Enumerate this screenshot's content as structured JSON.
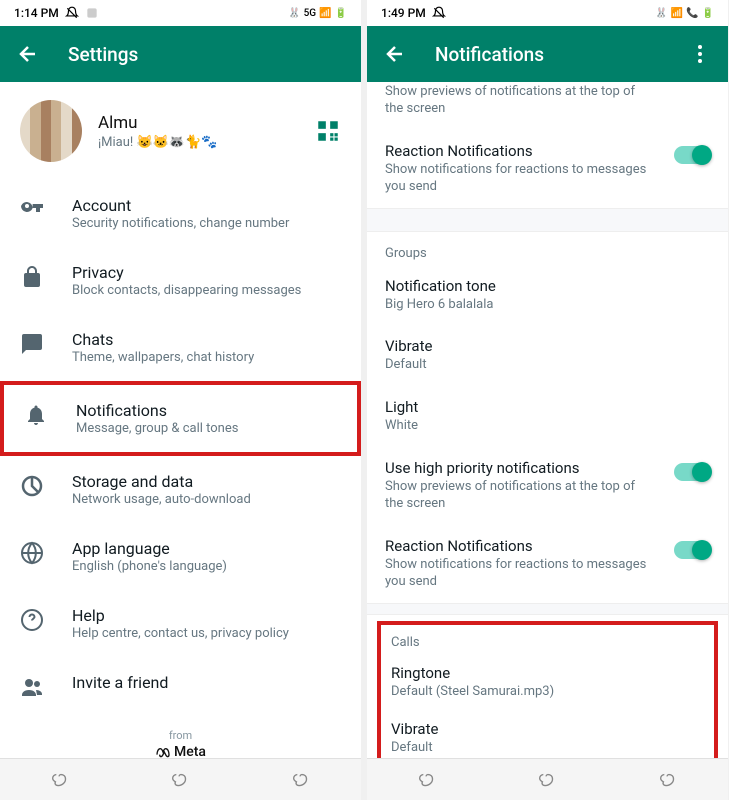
{
  "left": {
    "status": {
      "time": "1:14 PM",
      "network": "5G"
    },
    "appbar": {
      "title": "Settings"
    },
    "profile": {
      "name": "Almu",
      "status": "¡Miau! 😺🐱🦝🐈🐾"
    },
    "items": [
      {
        "title": "Account",
        "subtitle": "Security notifications, change number"
      },
      {
        "title": "Privacy",
        "subtitle": "Block contacts, disappearing messages"
      },
      {
        "title": "Chats",
        "subtitle": "Theme, wallpapers, chat history"
      },
      {
        "title": "Notifications",
        "subtitle": "Message, group & call tones"
      },
      {
        "title": "Storage and data",
        "subtitle": "Network usage, auto-download"
      },
      {
        "title": "App language",
        "subtitle": "English (phone's language)"
      },
      {
        "title": "Help",
        "subtitle": "Help centre, contact us, privacy policy"
      },
      {
        "title": "Invite a friend",
        "subtitle": ""
      }
    ],
    "footer": {
      "from": "from",
      "brand": "Meta"
    }
  },
  "right": {
    "status": {
      "time": "1:49 PM"
    },
    "appbar": {
      "title": "Notifications"
    },
    "partial_text": "Show previews of notifications at the top of the screen",
    "reaction": {
      "title": "Reaction Notifications",
      "subtitle": "Show notifications for reactions to messages you send"
    },
    "groups": {
      "header": "Groups",
      "tone": {
        "title": "Notification tone",
        "subtitle": "Big Hero 6 balalala"
      },
      "vibrate": {
        "title": "Vibrate",
        "subtitle": "Default"
      },
      "light": {
        "title": "Light",
        "subtitle": "White"
      },
      "highprio": {
        "title": "Use high priority notifications",
        "subtitle": "Show previews of notifications at the top of the screen"
      },
      "reaction": {
        "title": "Reaction Notifications",
        "subtitle": "Show notifications for reactions to messages you send"
      }
    },
    "calls": {
      "header": "Calls",
      "ringtone": {
        "title": "Ringtone",
        "subtitle": "Default (Steel Samurai.mp3)"
      },
      "vibrate": {
        "title": "Vibrate",
        "subtitle": "Default"
      }
    }
  }
}
